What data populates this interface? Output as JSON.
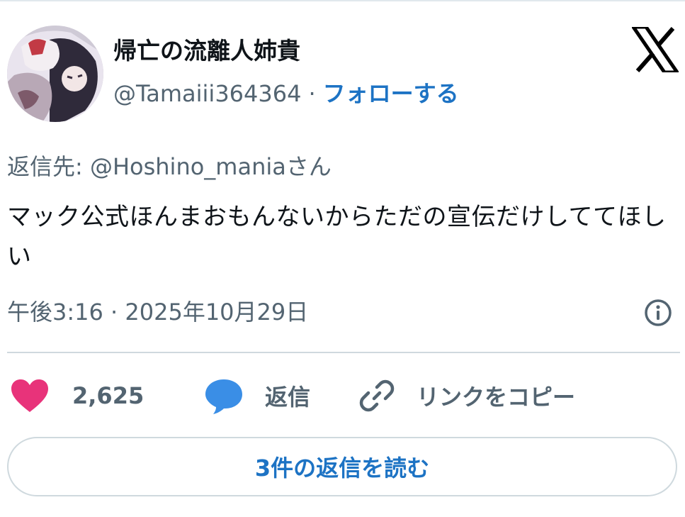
{
  "tweet": {
    "display_name": "帰亡の流離人姉貴",
    "handle": "@Tamaiii364364",
    "separator": "·",
    "follow_label": "フォローする",
    "reply_to": "返信先: @Hoshino_maniaさん",
    "text": "マック公式ほんまおもんないからただの宣伝だけしててほしい",
    "timestamp": "午後3:16 · 2025年10月29日"
  },
  "actions": {
    "like_count": "2,625",
    "reply_label": "返信",
    "copy_link_label": "リンクをコピー"
  },
  "read_replies_label": "3件の返信を読む",
  "icons": {
    "brand": "x-logo-icon",
    "info": "info-icon",
    "like": "heart-icon",
    "reply": "speech-bubble-icon",
    "link": "link-icon"
  },
  "colors": {
    "accent": "#1d73c4",
    "like": "#e8337a",
    "reply_icon": "#3a8ee6",
    "muted": "#536471",
    "text": "#0f1419",
    "border": "#cfd9de"
  }
}
